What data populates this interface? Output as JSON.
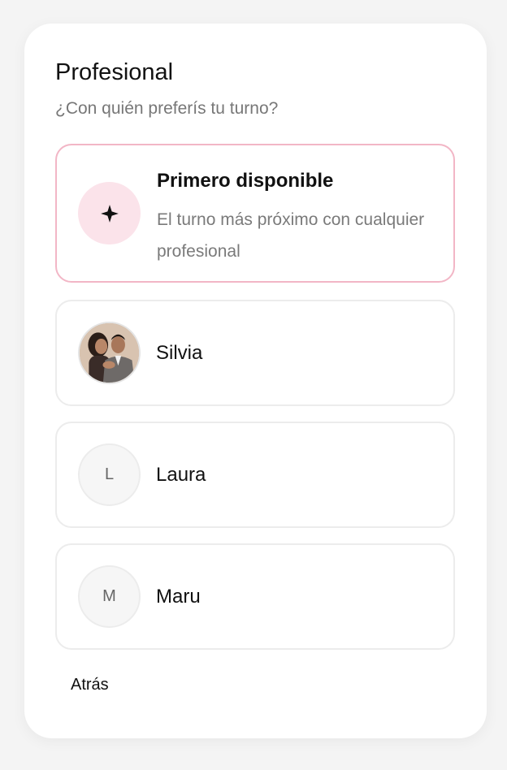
{
  "section": {
    "title": "Profesional",
    "subtitle": "¿Con quién preferís tu turno?"
  },
  "options": [
    {
      "name": "Primero disponible",
      "description": "El turno más próximo con cualquier profesional",
      "icon": "sparkle-icon",
      "selected": true
    },
    {
      "name": "Silvia",
      "avatar": "photo"
    },
    {
      "name": "Laura",
      "initial": "L"
    },
    {
      "name": "Maru",
      "initial": "M"
    }
  ],
  "footer": {
    "back_label": "Atrás"
  },
  "colors": {
    "selected_border": "#f2b6c6",
    "accent_bg": "#fbe3ea",
    "card_bg": "#ffffff",
    "page_bg": "#f4f4f4"
  }
}
